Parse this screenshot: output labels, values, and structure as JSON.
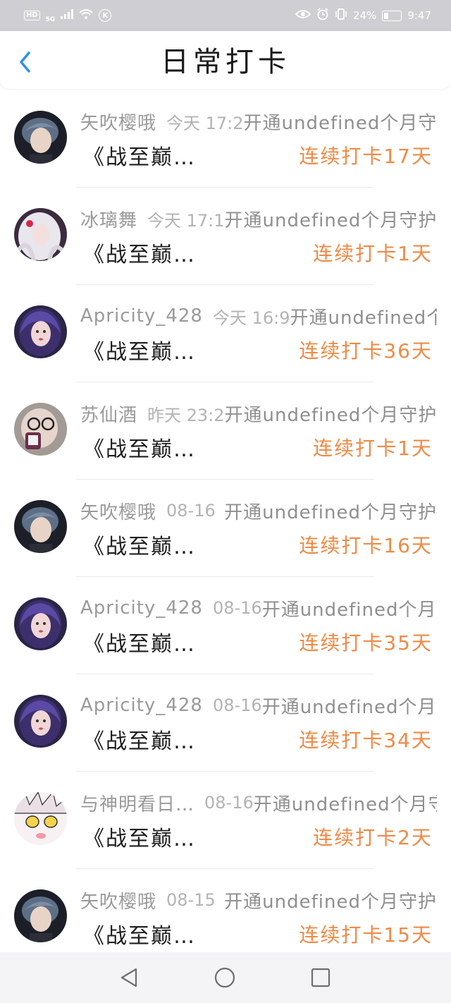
{
  "status_bar": {
    "hd": "HD",
    "network": "5G",
    "battery": "24%",
    "time": "9:47"
  },
  "header": {
    "title": "日常打卡"
  },
  "records": [
    {
      "name": "矢吹樱哦",
      "time": "今天 17:2",
      "action": "开通undefined个月守护",
      "game": "《战至巅…",
      "streak": "连续打卡17天",
      "avatar": "boy-a"
    },
    {
      "name": "冰璃舞",
      "time": "今天 17:1",
      "action": "开通undefined个月守护",
      "game": "《战至巅…",
      "streak": "连续打卡1天",
      "avatar": "white-hair"
    },
    {
      "name": "Apricity_428",
      "time": "今天 16:9",
      "action": "开通undefined个月守护",
      "game": "《战至巅…",
      "streak": "连续打卡36天",
      "avatar": "purple-girl"
    },
    {
      "name": "苏仙酒",
      "time": "昨天 23:2",
      "action": "开通undefined个月守护",
      "game": "《战至巅…",
      "streak": "连续打卡1天",
      "avatar": "glasses"
    },
    {
      "name": "矢吹樱哦",
      "time": "08-16",
      "action": "开通undefined个月守护",
      "game": "《战至巅…",
      "streak": "连续打卡16天",
      "avatar": "boy-a"
    },
    {
      "name": "Apricity_428",
      "time": "08-16",
      "action": "开通undefined个月守护",
      "game": "《战至巅…",
      "streak": "连续打卡35天",
      "avatar": "purple-girl"
    },
    {
      "name": "Apricity_428",
      "time": "08-16",
      "action": "开通undefined个月守护",
      "game": "《战至巅…",
      "streak": "连续打卡34天",
      "avatar": "purple-girl"
    },
    {
      "name": "与神明看日…",
      "time": "08-16",
      "action": "开通undefined个月守护",
      "game": "《战至巅…",
      "streak": "连续打卡2天",
      "avatar": "anime"
    },
    {
      "name": "矢吹樱哦",
      "time": "08-15",
      "action": "开通undefined个月守护",
      "game": "《战至巅…",
      "streak": "连续打卡15天",
      "avatar": "boy-a"
    }
  ],
  "colors": {
    "accent": "#ef8a45",
    "back": "#2f8fe6",
    "status_bar": "#cfcfd3"
  }
}
